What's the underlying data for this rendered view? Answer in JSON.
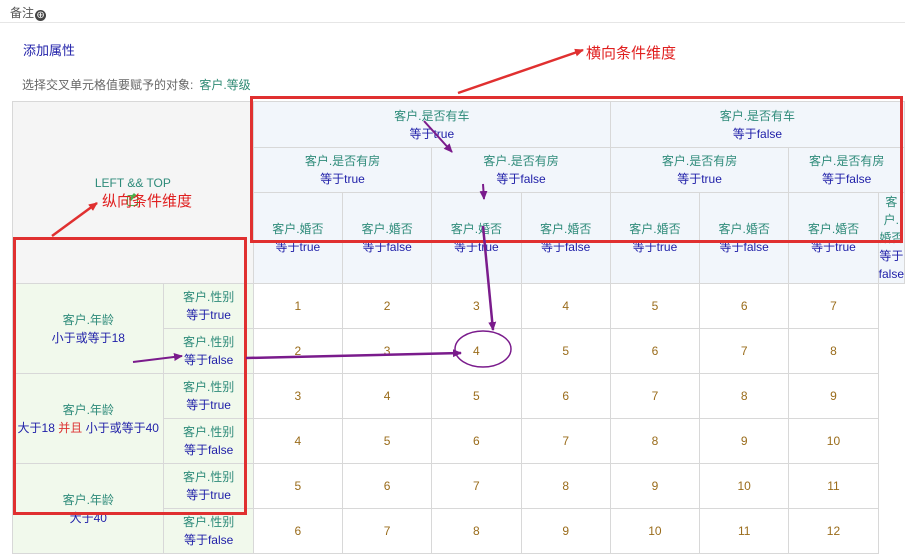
{
  "topbar": {
    "label": "备注",
    "plus_icon": "⊕"
  },
  "add_attribute": "添加属性",
  "select_target": {
    "label": "选择交叉单元格值要赋予的对象:",
    "value": "客户.等级"
  },
  "corner": {
    "label": "LEFT && TOP"
  },
  "top_headers": {
    "car": [
      {
        "name": "客户.是否有车",
        "cond": "等于true"
      },
      {
        "name": "客户.是否有车",
        "cond": "等于false"
      }
    ],
    "house": [
      {
        "name": "客户.是否有房",
        "cond": "等于true"
      },
      {
        "name": "客户.是否有房",
        "cond": "等于false"
      },
      {
        "name": "客户.是否有房",
        "cond": "等于true"
      },
      {
        "name": "客户.是否有房",
        "cond": "等于false"
      }
    ],
    "married": [
      {
        "name": "客户.婚否",
        "cond": "等于true"
      },
      {
        "name": "客户.婚否",
        "cond": "等于false"
      },
      {
        "name": "客户.婚否",
        "cond": "等于true"
      },
      {
        "name": "客户.婚否",
        "cond": "等于false"
      },
      {
        "name": "客户.婚否",
        "cond": "等于true"
      },
      {
        "name": "客户.婚否",
        "cond": "等于false"
      },
      {
        "name": "客户.婚否",
        "cond": "等于true"
      },
      {
        "name": "客户.婚否",
        "cond": "等于false"
      }
    ]
  },
  "left_headers": {
    "age": [
      {
        "name": "客户.年龄",
        "cond": "小于或等于18"
      },
      {
        "name": "客户.年龄",
        "cond_a": "大于18",
        "and": "并且",
        "cond_b": "小于或等于40"
      },
      {
        "name": "客户.年龄",
        "cond": "大于40"
      }
    ],
    "gender": [
      {
        "name": "客户.性别",
        "cond": "等于true"
      },
      {
        "name": "客户.性别",
        "cond": "等于false"
      },
      {
        "name": "客户.性别",
        "cond": "等于true"
      },
      {
        "name": "客户.性别",
        "cond": "等于false"
      },
      {
        "name": "客户.性别",
        "cond": "等于true"
      },
      {
        "name": "客户.性别",
        "cond": "等于false"
      }
    ]
  },
  "cells": [
    [
      "1",
      "2",
      "3",
      "4",
      "5",
      "6",
      "7"
    ],
    [
      "2",
      "3",
      "4",
      "5",
      "6",
      "7",
      "8"
    ],
    [
      "3",
      "4",
      "5",
      "6",
      "7",
      "8",
      "9"
    ],
    [
      "4",
      "5",
      "6",
      "7",
      "8",
      "9",
      "10"
    ],
    [
      "5",
      "6",
      "7",
      "8",
      "9",
      "10",
      "11"
    ],
    [
      "6",
      "7",
      "8",
      "9",
      "10",
      "11",
      "12"
    ]
  ],
  "annotations": {
    "horizontal": "横向条件维度",
    "vertical": "纵向条件维度"
  },
  "colors": {
    "annotation_red": "#e02020",
    "arrow_purple": "#7a1b8c",
    "link_blue": "#1e1ea8",
    "teal": "#2e8b7a",
    "cell_value": "#9a6c1b"
  }
}
